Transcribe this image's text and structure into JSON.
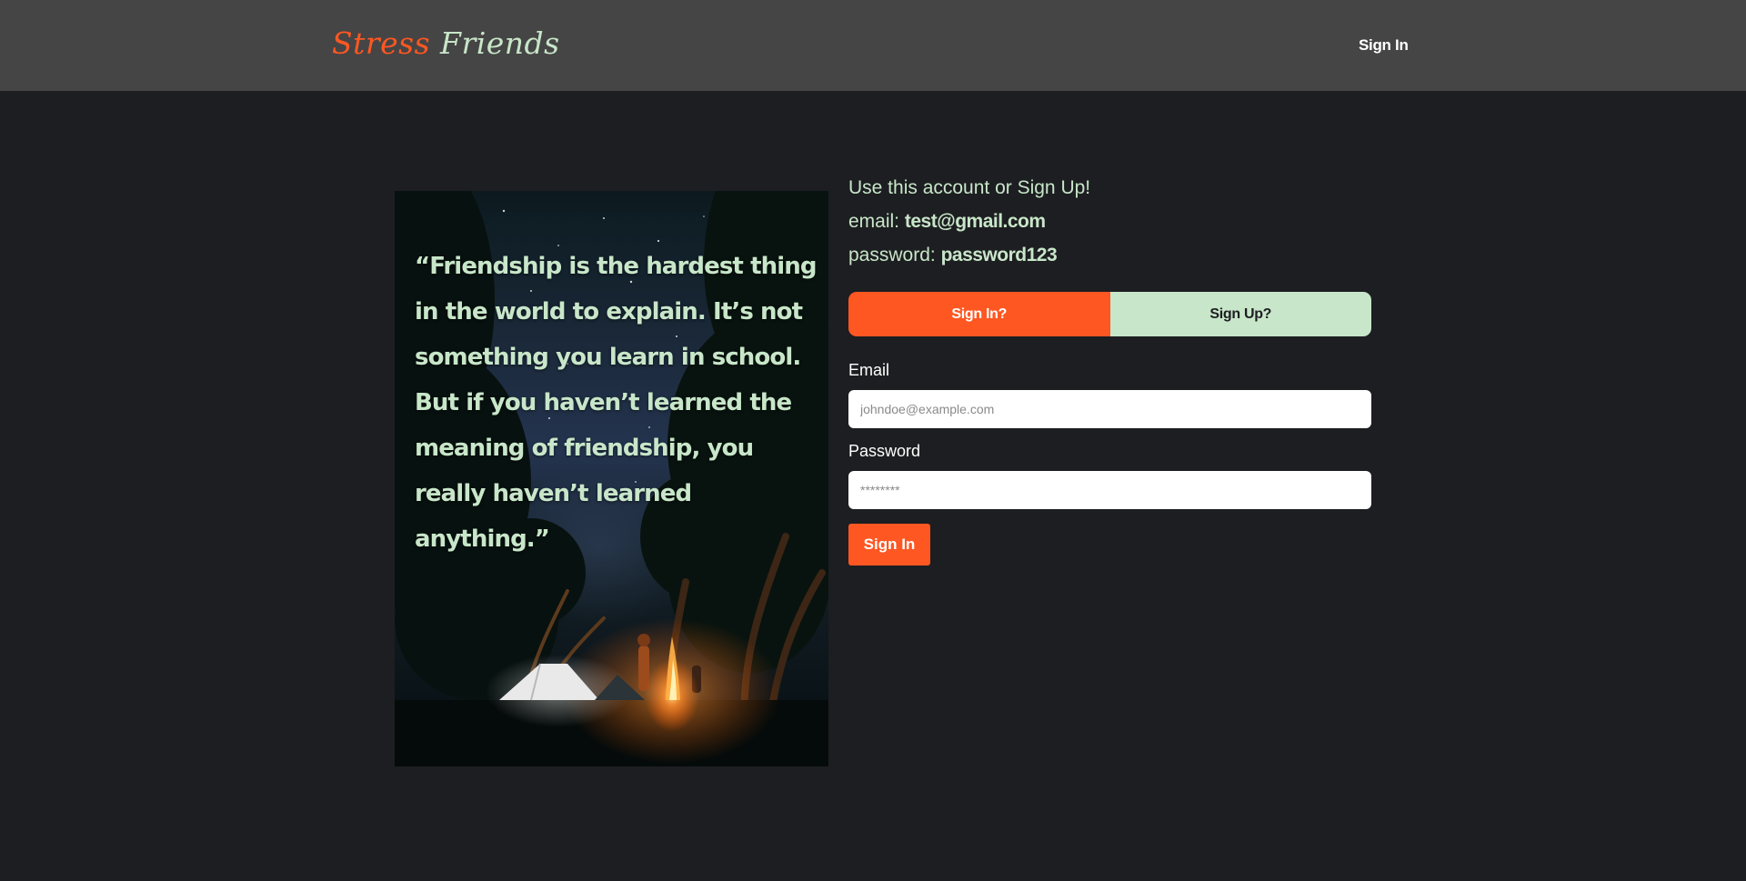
{
  "header": {
    "brand_word_1": "Stress",
    "brand_word_2": "Friends",
    "nav_sign_in": "Sign In"
  },
  "hero": {
    "quote": "“Friendship is the hardest thing in the world to explain. It’s not something you learn in school. But if you haven’t learned the meaning of friendship, you really haven’t learned anything.”"
  },
  "demo": {
    "intro": "Use this account or Sign Up!",
    "email_label": "email:",
    "email_value": "test@gmail.com",
    "password_label": "password:",
    "password_value": "password123"
  },
  "form": {
    "toggle_signin": "Sign In?",
    "toggle_signup": "Sign Up?",
    "email_label": "Email",
    "email_placeholder": "johndoe@example.com",
    "password_label": "Password",
    "password_placeholder": "********",
    "submit_label": "Sign In"
  },
  "colors": {
    "accent": "#ff5722",
    "mint": "#c8e6c9",
    "header_bg": "#454545",
    "page_bg": "#1d1e21"
  }
}
